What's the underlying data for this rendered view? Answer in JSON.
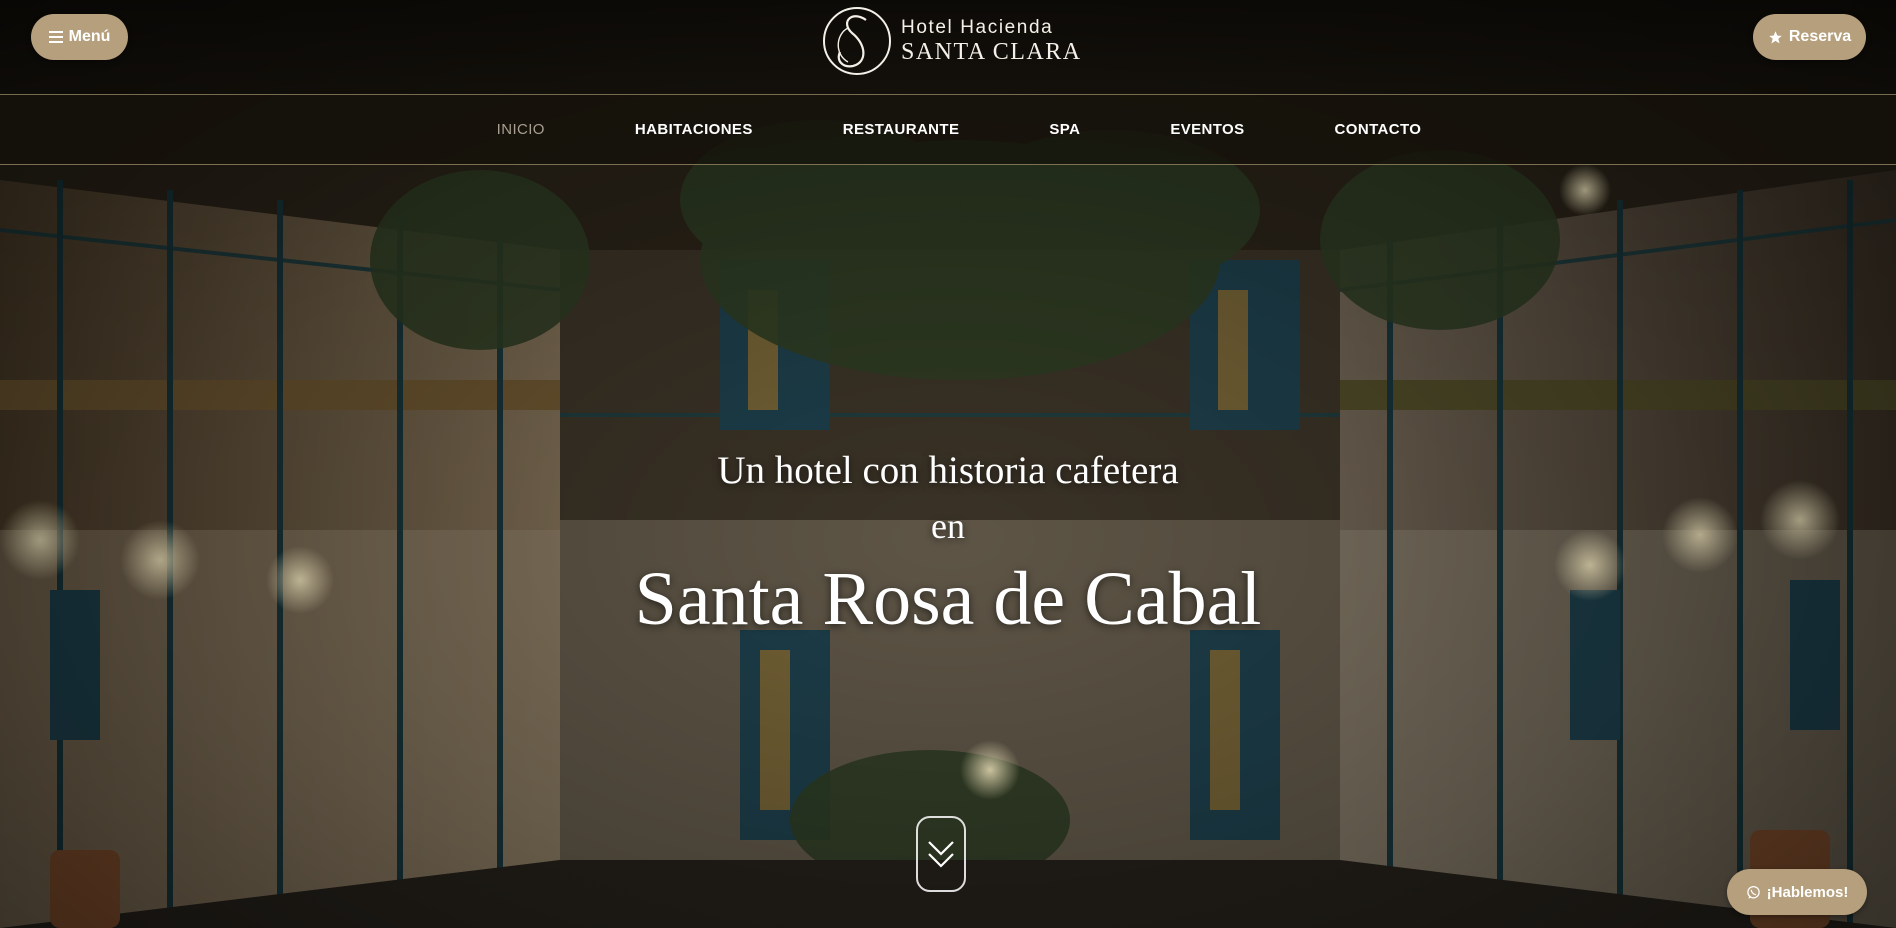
{
  "header": {
    "menu_label": "Menú",
    "reserve_label": "Reserva",
    "logo": {
      "line1": "Hotel Hacienda",
      "line2": "SANTA CLARA"
    }
  },
  "nav": {
    "items": [
      {
        "label": "INICIO",
        "active": true
      },
      {
        "label": "HABITACIONES"
      },
      {
        "label": "RESTAURANTE"
      },
      {
        "label": "SPA"
      },
      {
        "label": "EVENTOS"
      },
      {
        "label": "CONTACTO"
      }
    ]
  },
  "hero": {
    "line1": "Un hotel con historia cafetera",
    "line2": "en",
    "line3": "Santa Rosa de Cabal"
  },
  "chat": {
    "label": "¡Hablemos!"
  },
  "colors": {
    "accent": "#b69f7c",
    "nav_active": "#a89f91",
    "divider": "#d2be8c"
  }
}
